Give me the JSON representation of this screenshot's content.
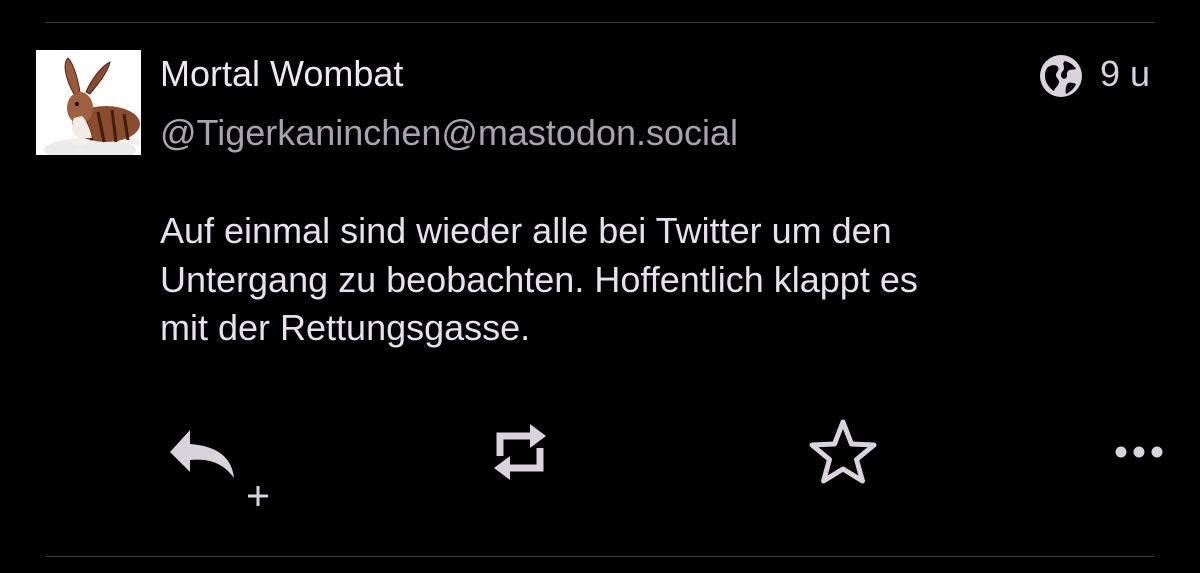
{
  "post": {
    "author": {
      "display_name": "Mortal Wombat",
      "handle": "@Tigerkaninchen@mastodon.social",
      "avatar": "rabbit-avatar"
    },
    "visibility_icon": "globe-icon",
    "timestamp": "9 u",
    "content_lines": [
      "Auf einmal sind wieder alle bei Twitter um den",
      "Untergang zu beobachten. Hoffentlich klappt es",
      "mit der Rettungsgasse."
    ]
  },
  "actions": [
    {
      "name": "reply",
      "icon": "reply-icon"
    },
    {
      "name": "boost",
      "icon": "boost-icon"
    },
    {
      "name": "favourite",
      "icon": "star-icon"
    },
    {
      "name": "more",
      "icon": "more-icon"
    }
  ],
  "colors": {
    "background": "#000000",
    "text_primary": "#e6e1ec",
    "text_secondary": "#a8a3ae",
    "icon": "#d8d3dd",
    "divider": "#3d3a43"
  }
}
